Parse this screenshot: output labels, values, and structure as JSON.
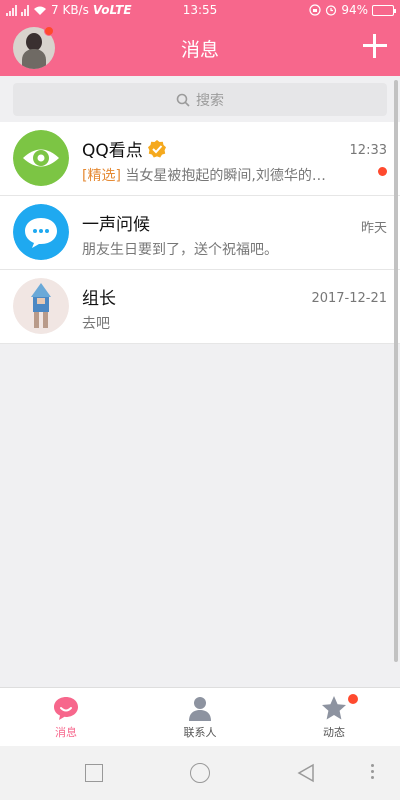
{
  "status_bar": {
    "network_speed": "7 KB/s",
    "network_type": "VoLTE",
    "time": "13:55",
    "battery": "94%",
    "battery_level": 0.94
  },
  "header": {
    "title": "消息",
    "add_button_icon": "plus-icon"
  },
  "search": {
    "placeholder": "搜索"
  },
  "conversations": [
    {
      "name": "QQ看点",
      "time": "12:33",
      "tag": "[精选]",
      "preview": " 当女星被抱起的瞬间,刘德华的…",
      "verified": true,
      "unread": true
    },
    {
      "name": "一声问候",
      "time": "昨天",
      "tag": "",
      "preview": "朋友生日要到了，送个祝福吧。",
      "verified": false,
      "unread": false
    },
    {
      "name": "组长",
      "time": "2017-12-21",
      "tag": "",
      "preview": "去吧",
      "verified": false,
      "unread": false
    }
  ],
  "tabs": [
    {
      "label": "消息",
      "icon": "chat-bubble-icon",
      "active": true
    },
    {
      "label": "联系人",
      "icon": "person-icon",
      "active": false
    },
    {
      "label": "动态",
      "icon": "star-icon",
      "active": false,
      "badge": true
    }
  ],
  "colors": {
    "brand": "#f7678c",
    "badge": "#ff4a2e",
    "tag": "#e58a34",
    "qq_kandian_green": "#7cc544",
    "greeting_blue": "#1fa9f0"
  }
}
